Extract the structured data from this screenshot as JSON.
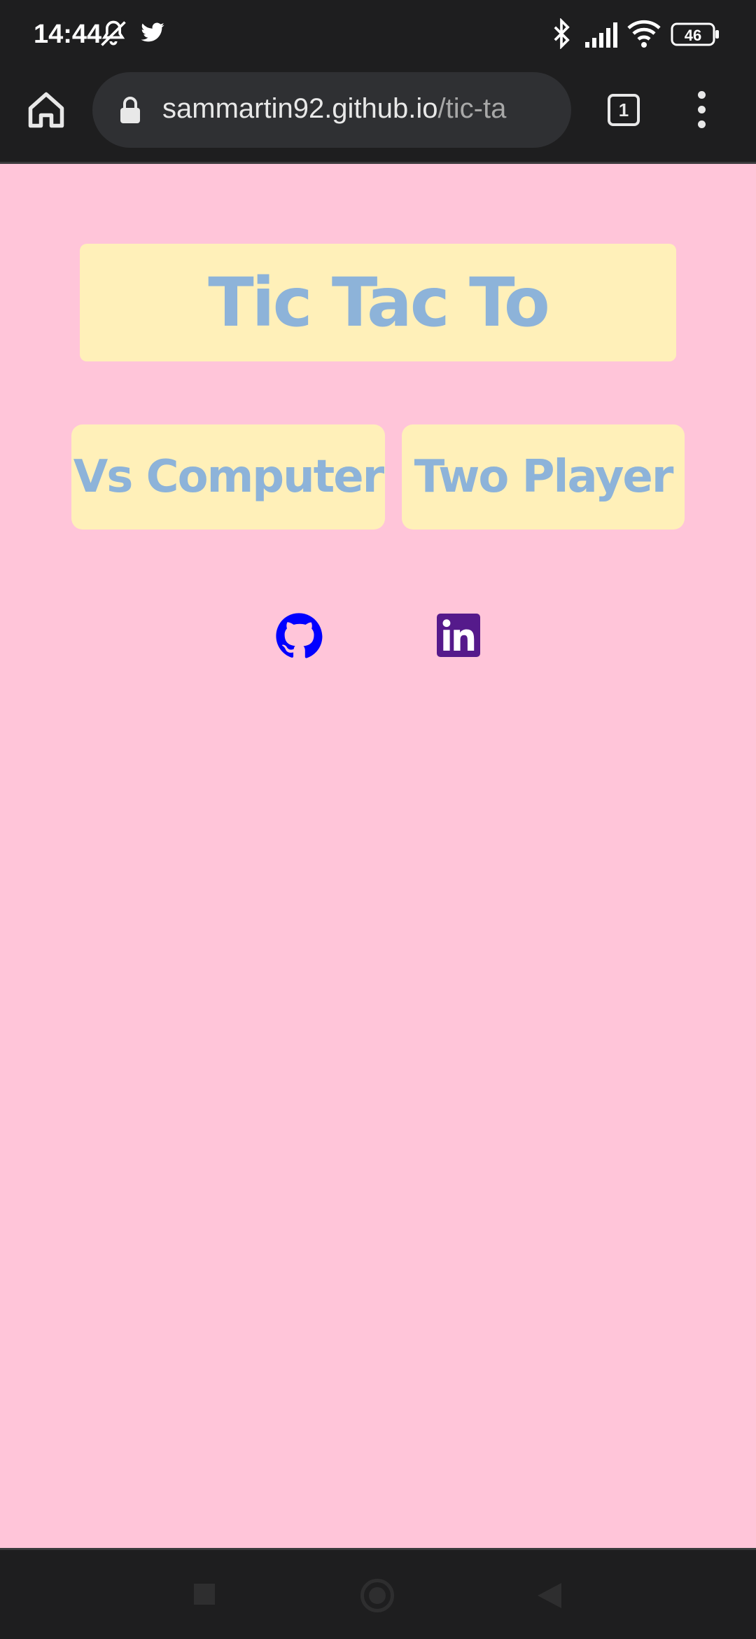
{
  "status_bar": {
    "time": "14:44",
    "battery": "46",
    "icons": [
      "mute-icon",
      "twitter-icon",
      "bluetooth-icon",
      "signal-icon",
      "wifi-icon",
      "battery-icon"
    ]
  },
  "browser": {
    "url_host": "sammartin92.github.io",
    "url_path": "/tic-ta",
    "tab_count": "1"
  },
  "page": {
    "title": "Tic Tac To",
    "buttons": {
      "vs_computer": "Vs Computer",
      "two_player": "Two Player"
    },
    "social": [
      "github-icon",
      "linkedin-icon"
    ]
  },
  "colors": {
    "page_background": "#ffc5d9",
    "panel_background": "#fff0b9",
    "accent_text": "#8db3d9",
    "github": "#0000ff",
    "linkedin": "#551a8b"
  }
}
